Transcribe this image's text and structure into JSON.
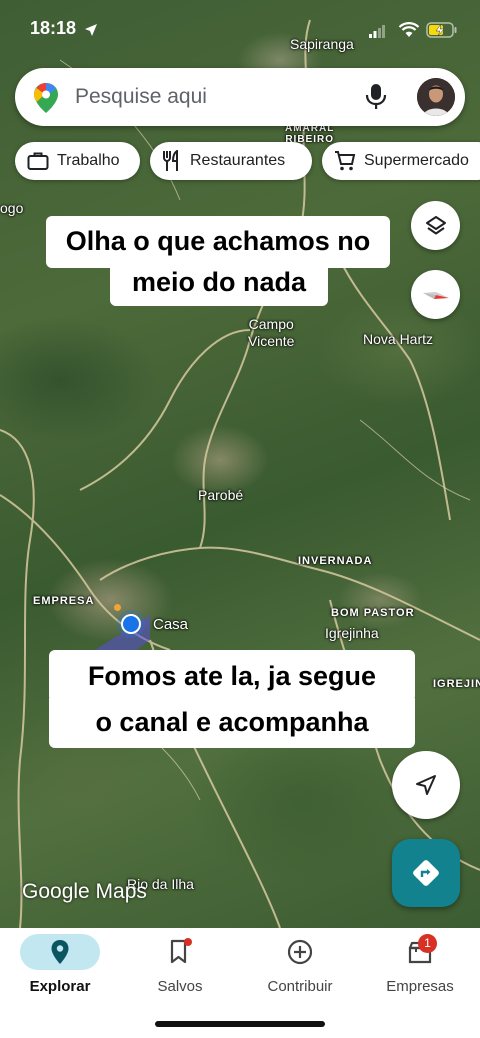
{
  "status": {
    "time": "18:18"
  },
  "search": {
    "placeholder": "Pesquise aqui"
  },
  "chips": [
    {
      "label": "Trabalho",
      "icon": "briefcase-icon"
    },
    {
      "label": "Restaurantes",
      "icon": "restaurant-icon"
    },
    {
      "label": "Supermercado",
      "icon": "cart-icon"
    }
  ],
  "map_labels": {
    "sapiranga": "Sapiranga",
    "amaral_ribeiro": "AMARAL\nRIBEIRO",
    "ogo": "ogo",
    "campo_vicente": "Campo\nVicente",
    "nova_hartz": "Nova Hartz",
    "parobe": "Parobé",
    "invernada": "INVERNADA",
    "empresa": "EMPRESA",
    "bom_pastor": "BOM PASTOR",
    "igrejinha": "Igrejinha",
    "igrejin": "IGREJIN",
    "casa": "Casa",
    "rio_da_ilha": "Rio da Ilha"
  },
  "captions": {
    "top_line1": "Olha o que achamos no",
    "top_line2": "meio do nada",
    "bottom_line1": "Fomos ate la, ja segue",
    "bottom_line2": "o canal e acompanha"
  },
  "brand": "Google Maps",
  "nav": {
    "items": [
      {
        "label": "Explorar",
        "icon": "location-pin-icon",
        "active": true
      },
      {
        "label": "Salvos",
        "icon": "bookmark-icon"
      },
      {
        "label": "Contribuir",
        "icon": "add-circle-icon"
      },
      {
        "label": "Empresas",
        "icon": "store-icon",
        "badge": "1"
      }
    ]
  },
  "colors": {
    "accent": "#1a73e8",
    "directions": "#11828e",
    "active_tab": "#c2e7f0",
    "badge": "#d93025"
  }
}
